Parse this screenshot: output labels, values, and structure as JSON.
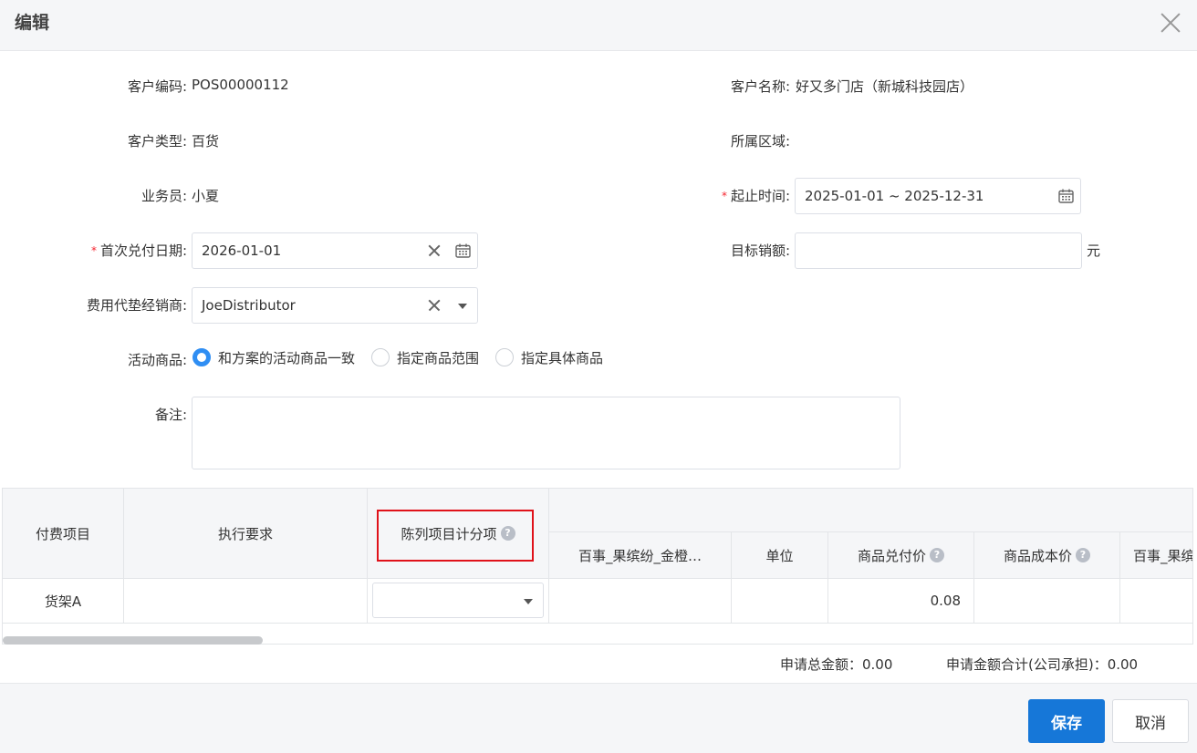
{
  "dialog": {
    "title": "编辑"
  },
  "form": {
    "customer_code": {
      "label": "客户编码:",
      "value": "POS00000112"
    },
    "customer_name": {
      "label": "客户名称:",
      "value": "好又多门店（新城科技园店）"
    },
    "customer_type": {
      "label": "客户类型:",
      "value": "百货"
    },
    "region": {
      "label": "所属区域:",
      "value": ""
    },
    "salesperson": {
      "label": "业务员:",
      "value": "小夏"
    },
    "period": {
      "required": "*",
      "label": "起止时间:",
      "value": "2025-01-01 ~ 2025-12-31"
    },
    "first_pay_date": {
      "required": "*",
      "label": "首次兑付日期:",
      "value": "2026-01-01"
    },
    "target_sales": {
      "label": "目标销额:",
      "value": "",
      "unit": "元"
    },
    "distributor": {
      "label": "费用代垫经销商:",
      "value": "JoeDistributor"
    },
    "activity_goods": {
      "label": "活动商品:",
      "options": [
        "和方案的活动商品一致",
        "指定商品范围",
        "指定具体商品"
      ],
      "selected_index": 0
    },
    "remark": {
      "label": "备注:",
      "value": ""
    }
  },
  "table": {
    "headers": {
      "pay_item": "付费项目",
      "requirement": "执行要求",
      "display_sub": "陈列项目计分项",
      "product": "百事_果缤纷_金橙…",
      "unit": "单位",
      "pay_price": "商品兑付价",
      "cost_price": "商品成本价",
      "product2": "百事_果缤"
    },
    "rows": [
      {
        "pay_item": "货架A",
        "requirement": "",
        "display_sub": "",
        "product": "",
        "unit": "",
        "pay_price": "0.08",
        "cost_price": "",
        "product2": ""
      }
    ]
  },
  "totals": {
    "apply_total": "申请总金额：0.00",
    "company_total": "申请金额合计(公司承担)：0.00"
  },
  "footer": {
    "save": "保存",
    "cancel": "取消"
  },
  "colors": {
    "primary": "#1677d8",
    "radio_checked": "#2f8ef3",
    "required": "#f5222d",
    "highlight": "#e0121a"
  }
}
